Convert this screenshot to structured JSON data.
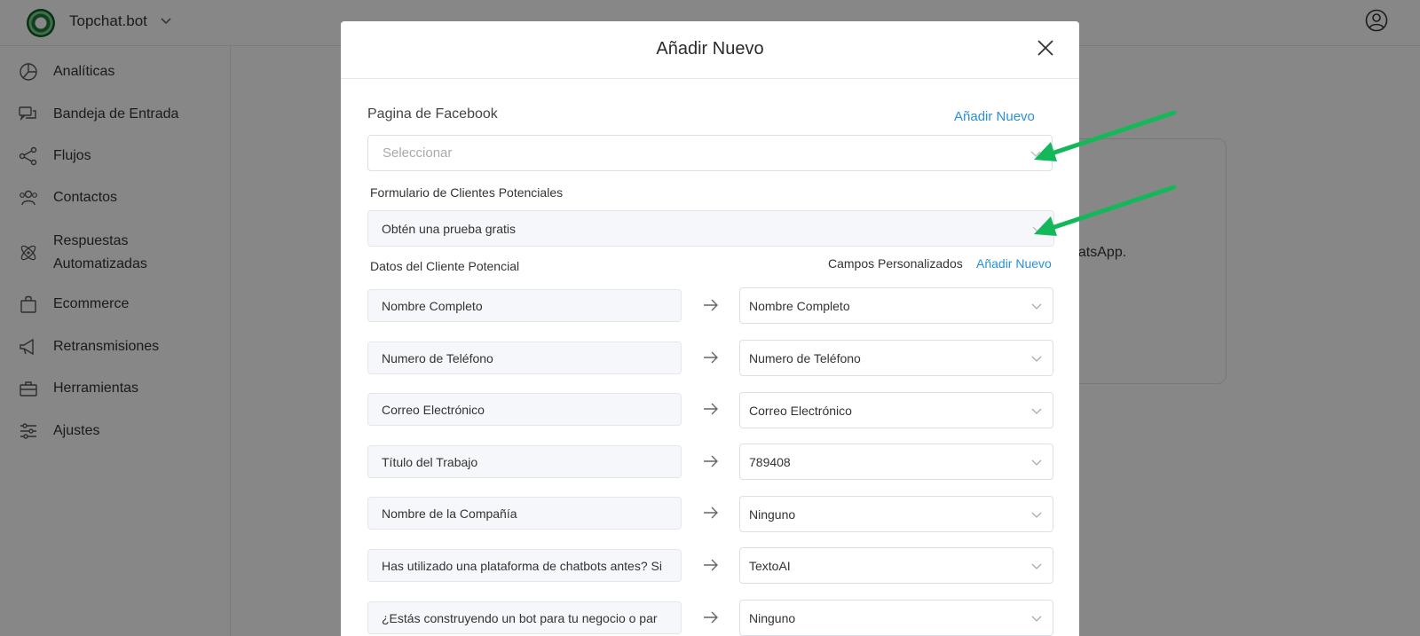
{
  "app": {
    "brand": "Topchat.bot"
  },
  "sidebar": {
    "items": [
      {
        "label": "Analíticas",
        "icon": "pie-chart-icon"
      },
      {
        "label": "Bandeja de Entrada",
        "icon": "chat-bubbles-icon"
      },
      {
        "label": "Flujos",
        "icon": "share-nodes-icon"
      },
      {
        "label": "Contactos",
        "icon": "users-icon"
      },
      {
        "label": "Respuestas",
        "label2": "Automatizadas",
        "icon": "atom-icon"
      },
      {
        "label": "Ecommerce",
        "icon": "shopping-bag-icon"
      },
      {
        "label": "Retransmisiones",
        "icon": "megaphone-icon"
      },
      {
        "label": "Herramientas",
        "icon": "toolbox-icon"
      },
      {
        "label": "Ajustes",
        "icon": "sliders-icon"
      }
    ]
  },
  "background": {
    "text": "hatsApp."
  },
  "modal": {
    "title": "Añadir Nuevo",
    "facebook_label": "Pagina de Facebook",
    "facebook_add": "Añadir Nuevo",
    "facebook_placeholder": "Seleccionar",
    "form_label": "Formulario de Clientes Potenciales",
    "form_value": "Obtén una prueba gratis",
    "lead_data_label": "Datos del Cliente Potencial",
    "custom_fields_label": "Campos Personalizados",
    "custom_fields_add": "Añadir Nuevo",
    "mappings": [
      {
        "source": "Nombre Completo",
        "target": "Nombre Completo"
      },
      {
        "source": "Numero de Teléfono",
        "target": "Numero de Teléfono"
      },
      {
        "source": "Correo Electrónico",
        "target": "Correo Electrónico"
      },
      {
        "source": "Título del Trabajo",
        "target": "789408"
      },
      {
        "source": "Nombre de la Compañía",
        "target": "Ninguno"
      },
      {
        "source": "Has utilizado una plataforma de chatbots antes? Si",
        "target": "TextoAI"
      },
      {
        "source": "¿Estás construyendo un bot para tu negocio o par",
        "target": "Ninguno"
      }
    ]
  },
  "colors": {
    "link": "#2a8fd8",
    "annotation_arrow": "#14b85a",
    "overlay": "rgba(0,0,0,0.47)"
  }
}
